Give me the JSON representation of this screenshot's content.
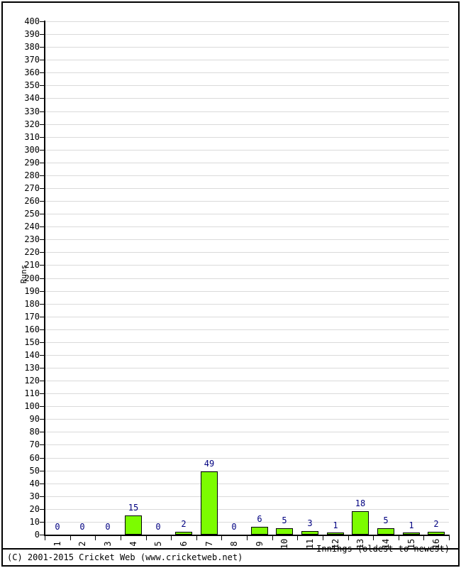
{
  "chart_data": {
    "type": "bar",
    "title": "",
    "xlabel": "Innings (oldest to newest)",
    "ylabel": "Runs",
    "categories": [
      "1",
      "2",
      "3",
      "4",
      "5",
      "6",
      "7",
      "8",
      "9",
      "10",
      "11",
      "12",
      "13",
      "14",
      "15",
      "16"
    ],
    "values": [
      0,
      0,
      0,
      15,
      0,
      2,
      49,
      0,
      6,
      5,
      3,
      1,
      18,
      5,
      1,
      2
    ],
    "ylim": [
      0,
      400
    ],
    "ytick_step": 10,
    "yticks": [
      0,
      10,
      20,
      30,
      40,
      50,
      60,
      70,
      80,
      90,
      100,
      110,
      120,
      130,
      140,
      150,
      160,
      170,
      180,
      190,
      200,
      210,
      220,
      230,
      240,
      250,
      260,
      270,
      280,
      290,
      300,
      310,
      320,
      330,
      340,
      350,
      360,
      370,
      380,
      390,
      400
    ],
    "grid": true,
    "legend": "none",
    "bar_color": "#7CFC00",
    "bar_border_color": "#000000",
    "value_label_color": "#000080",
    "gridline_color": "#DADADA",
    "axis_color": "#000000"
  },
  "footer": {
    "copyright": "(C) 2001-2015 Cricket Web (www.cricketweb.net)"
  }
}
